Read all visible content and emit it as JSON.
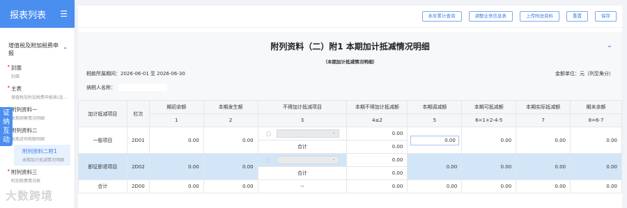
{
  "sidebar": {
    "header": "报表列表",
    "group": "增值税及附加税费申报",
    "items": [
      {
        "title": "封面",
        "sub": "封面"
      },
      {
        "title": "主表",
        "sub": "增值税及附加税费申报表(适..."
      },
      {
        "title": "附列资料一",
        "sub": "本期销售情况明细"
      },
      {
        "title": "附列资料二",
        "sub": "本期进项税额明细"
      },
      {
        "title": "附列资料二附1",
        "sub": "本期加计抵减情况明细"
      },
      {
        "title": "附列资料三",
        "sub": "附加税费情况表"
      }
    ],
    "float_tab": "证纳互动"
  },
  "watermark": "大数跨境",
  "toolbar": [
    "本年累计查询",
    "调整业务信息表",
    "上传附送资料",
    "重置",
    "保存"
  ],
  "form": {
    "title": "附列资料（二）附1 本期加计抵减情况明细",
    "subtitle": "（本期加计抵减情况明细）",
    "period": "税款所属期间：2026-06-01 至 2026-06-30",
    "unit": "金额单位：元（列至角分）",
    "taxpayer_label": "纳税人名称："
  },
  "table": {
    "headers": [
      "加计抵减项目",
      "栏次",
      "期初余额",
      "本期发生额",
      "不得加计抵减项目",
      "本期不得加计抵减额",
      "本期调减额",
      "本期可抵减额",
      "本期实际抵减额",
      "期末余额"
    ],
    "col_nums": [
      "1",
      "2",
      "3",
      "4≤2",
      "5",
      "6=1+2-4-5",
      "7",
      "8=6-7"
    ],
    "rows": [
      {
        "name": "一般项目",
        "code": "2D01",
        "c1": "0.00",
        "c2": "0.00",
        "c4a": "0.00",
        "sum_label": "合计",
        "c4b": "0.00",
        "c5": "0.00",
        "c6": "0.00",
        "c7": "0.00",
        "c8": "0.00"
      },
      {
        "name": "即征即退项目",
        "code": "2D02",
        "c1": "0.00",
        "c2": "0.00",
        "c4a": "0.00",
        "sum_label": "合计",
        "c4b": "0.00",
        "c5": "0.00",
        "c6": "0.00",
        "c7": "0.00",
        "c8": "0.00"
      },
      {
        "name": "合计",
        "code": "2D00",
        "c1": "0.00",
        "c2": "0.00",
        "c3": "--",
        "c4": "0.00",
        "c5": "0.00",
        "c6": "0.00",
        "c7": "0.00",
        "c8": "0.00"
      }
    ]
  }
}
